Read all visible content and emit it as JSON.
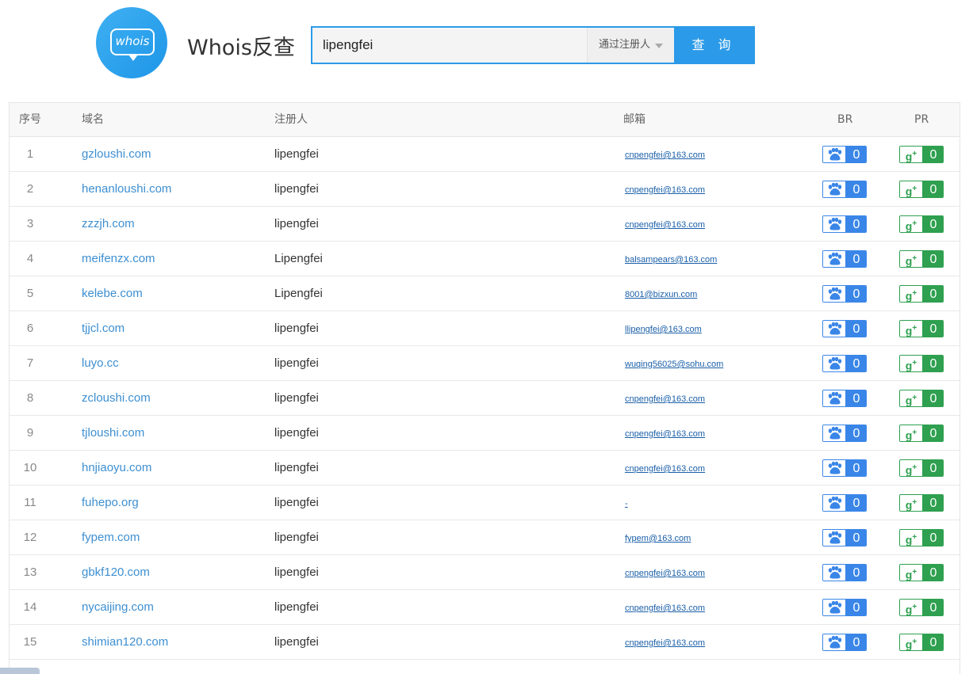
{
  "logo": {
    "text": "whois"
  },
  "title": "Whois反查",
  "search": {
    "value": "lipengfei",
    "select_label": "通过注册人",
    "button_label": "查 询"
  },
  "table": {
    "headers": {
      "idx": "序号",
      "domain": "域名",
      "registrant": "注册人",
      "email": "邮箱",
      "br": "BR",
      "pr": "PR"
    },
    "rows": [
      {
        "idx": "1",
        "domain": "gzloushi.com",
        "registrant": "lipengfei",
        "email": "cnpengfei@163.com",
        "br": "0",
        "pr": "0"
      },
      {
        "idx": "2",
        "domain": "henanloushi.com",
        "registrant": "lipengfei",
        "email": "cnpengfei@163.com",
        "br": "0",
        "pr": "0"
      },
      {
        "idx": "3",
        "domain": "zzzjh.com",
        "registrant": "lipengfei",
        "email": "cnpengfei@163.com",
        "br": "0",
        "pr": "0"
      },
      {
        "idx": "4",
        "domain": "meifenzx.com",
        "registrant": "Lipengfei",
        "email": "balsampears@163.com",
        "br": "0",
        "pr": "0"
      },
      {
        "idx": "5",
        "domain": "kelebe.com",
        "registrant": "Lipengfei",
        "email": "8001@bizxun.com",
        "br": "0",
        "pr": "0"
      },
      {
        "idx": "6",
        "domain": "tjjcl.com",
        "registrant": "lipengfei",
        "email": "llipengfei@163.com",
        "br": "0",
        "pr": "0"
      },
      {
        "idx": "7",
        "domain": "luyo.cc",
        "registrant": "lipengfei",
        "email": "wuqing56025@sohu.com",
        "br": "0",
        "pr": "0"
      },
      {
        "idx": "8",
        "domain": "zcloushi.com",
        "registrant": "lipengfei",
        "email": "cnpengfei@163.com",
        "br": "0",
        "pr": "0"
      },
      {
        "idx": "9",
        "domain": "tjloushi.com",
        "registrant": "lipengfei",
        "email": "cnpengfei@163.com",
        "br": "0",
        "pr": "0"
      },
      {
        "idx": "10",
        "domain": "hnjiaoyu.com",
        "registrant": "lipengfei",
        "email": "cnpengfei@163.com",
        "br": "0",
        "pr": "0"
      },
      {
        "idx": "11",
        "domain": "fuhepo.org",
        "registrant": "lipengfei",
        "email": "-",
        "br": "0",
        "pr": "0"
      },
      {
        "idx": "12",
        "domain": "fypem.com",
        "registrant": "lipengfei",
        "email": "fypem@163.com",
        "br": "0",
        "pr": "0"
      },
      {
        "idx": "13",
        "domain": "gbkf120.com",
        "registrant": "lipengfei",
        "email": "cnpengfei@163.com",
        "br": "0",
        "pr": "0"
      },
      {
        "idx": "14",
        "domain": "nycaijing.com",
        "registrant": "lipengfei",
        "email": "cnpengfei@163.com",
        "br": "0",
        "pr": "0"
      },
      {
        "idx": "15",
        "domain": "shimian120.com",
        "registrant": "lipengfei",
        "email": "cnpengfei@163.com",
        "br": "0",
        "pr": "0"
      }
    ]
  },
  "colors": {
    "accent": "#2b9ae8",
    "link": "#3d8fd1",
    "baidu_blue": "#3a86e8",
    "google_green": "#2ea04f"
  },
  "icons": {
    "br": "paw-icon",
    "pr": "google-plus-icon"
  }
}
